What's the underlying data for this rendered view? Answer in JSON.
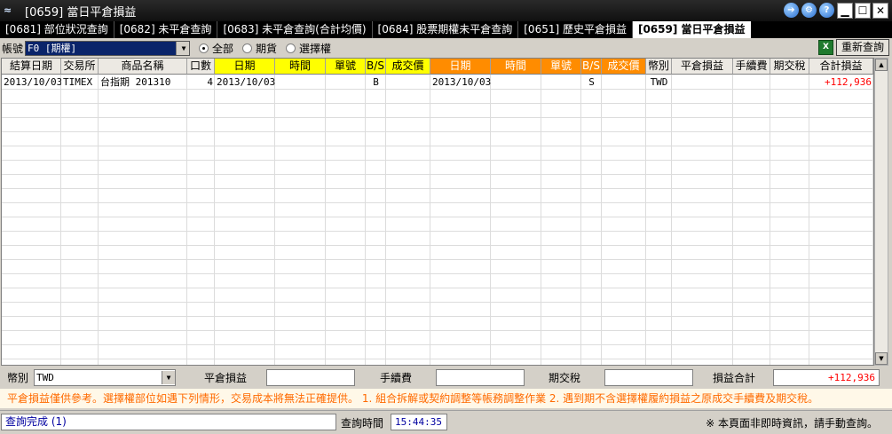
{
  "window": {
    "title": "[0659] 當日平倉損益",
    "app_icon": "app-logo-icon",
    "buttons": [
      "back-arrow-icon",
      "settings-icon",
      "help-icon",
      "minimize-icon",
      "maximize-icon",
      "close-icon"
    ],
    "button_glyphs": {
      "back": "➔",
      "settings": "⚙",
      "help": "?",
      "minimize": "▁",
      "maximize": "☐",
      "close": "✕"
    }
  },
  "tabs": [
    {
      "label": "[0681] 部位狀況查詢",
      "active": false
    },
    {
      "label": "[0682] 未平倉查詢",
      "active": false
    },
    {
      "label": "[0683] 未平倉查詢(合計均價)",
      "active": false
    },
    {
      "label": "[0684] 股票期權未平倉查詢",
      "active": false
    },
    {
      "label": "[0651] 歷史平倉損益",
      "active": false
    },
    {
      "label": "[0659] 當日平倉損益",
      "active": true
    }
  ],
  "filters": {
    "account_label": "帳號",
    "account_value": "F0          [期權]",
    "radios": [
      {
        "label": "全部",
        "checked": true
      },
      {
        "label": "期貨",
        "checked": false
      },
      {
        "label": "選擇權",
        "checked": false
      }
    ],
    "excel_label": "X",
    "requery_label": "重新查詢"
  },
  "table": {
    "headers": [
      "結算日期",
      "交易所",
      "商品名稱",
      "口數",
      "日期",
      "時間",
      "單號",
      "B/S",
      "成交價",
      "日期",
      "時間",
      "單號",
      "B/S",
      "成交價",
      "幣別",
      "平倉損益",
      "手續費",
      "期交稅",
      "合計損益"
    ],
    "rows": [
      [
        "2013/10/03",
        "TIMEX",
        "台指期 201310",
        "4",
        "2013/10/03",
        "",
        "",
        "B",
        "",
        "2013/10/03",
        "",
        "",
        "S",
        "",
        "TWD",
        "",
        "",
        "",
        "+112,936"
      ]
    ]
  },
  "summary": {
    "currency_label": "幣別",
    "currency_value": "TWD",
    "close_pl_label": "平倉損益",
    "close_pl_value": "",
    "fee_label": "手續費",
    "fee_value": "",
    "tax_label": "期交稅",
    "tax_value": "",
    "total_label": "損益合計",
    "total_value": "+112,936"
  },
  "notice": "平倉損益僅供參考。選擇權部位如遇下列情形，交易成本將無法正確提供。  1. 組合拆解或契約調整等帳務調整作業  2. 遇到期不含選擇權履約損益之原成交手續費及期交稅。",
  "status": {
    "message": "查詢完成 (1)",
    "query_time_label": "查詢時間",
    "query_time": "15:44:35",
    "disclaimer": "※ 本頁面非即時資訊，請手動查詢。"
  },
  "colors": {
    "open_header": "#ffff00",
    "close_header": "#ff8c00",
    "profit": "#ff0000",
    "notice_text": "#ff6a00"
  }
}
